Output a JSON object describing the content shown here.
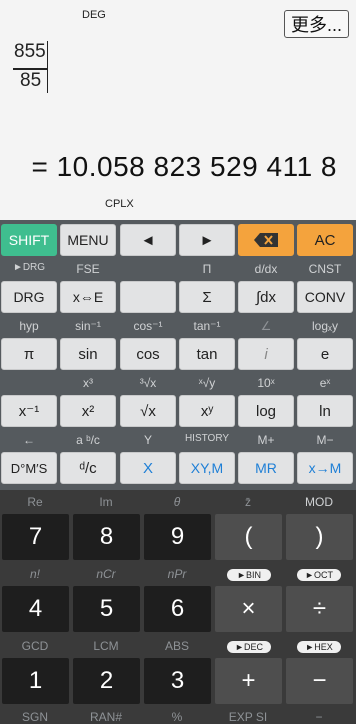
{
  "display": {
    "mode": "DEG",
    "more_label": "更多...",
    "numerator": "855",
    "denominator": "85",
    "result": "= 10.058 823 529 411 8",
    "status": "CPLX"
  },
  "row1": {
    "shift": "SHIFT",
    "menu": "MENU",
    "left": "◄",
    "right": "►",
    "backspace": "⌫",
    "ac": "AC"
  },
  "labels1": {
    "drg2": "►DRG",
    "fse": "FSE",
    "pi2": "Π",
    "ddx": "d/dx",
    "cnst": "CNST"
  },
  "row2": {
    "drg": "DRG",
    "xe": "x⇔E",
    "sigma": "Σ",
    "integral": "∫dx",
    "conv": "CONV"
  },
  "labels2": {
    "hyp": "hyp",
    "asin": "sin⁻¹",
    "acos": "cos⁻¹",
    "atan": "tan⁻¹",
    "angle": "∠",
    "logxy": "logₓy"
  },
  "row3": {
    "pi": "π",
    "sin": "sin",
    "cos": "cos",
    "tan": "tan",
    "i": "i",
    "e": "e"
  },
  "labels3": {
    "cube": "x³",
    "cbrt": "³√x",
    "xroot": "ˣ√y",
    "tenx": "10ˣ",
    "ex": "eˣ"
  },
  "row4": {
    "inv": "x⁻¹",
    "sq": "x²",
    "sqrt": "√x",
    "pow": "xʸ",
    "log": "log",
    "ln": "ln"
  },
  "labels4": {
    "arrow": "←",
    "abc": "a ᵇ/c",
    "y": "Y",
    "history": "HISTORY",
    "mplus": "M+",
    "mminus": "M−"
  },
  "row5": {
    "dms": "D°M′S",
    "dc": "ᵈ/c",
    "x": "X",
    "xym": "XY,M",
    "mr": "MR",
    "xm": "x→M"
  },
  "labels5": {
    "re": "Re",
    "im": "Im",
    "theta": "θ",
    "conj": "z̄",
    "mod": "MOD"
  },
  "row6": {
    "seven": "7",
    "eight": "8",
    "nine": "9",
    "lparen": "(",
    "rparen": ")"
  },
  "labels6": {
    "fact": "n!",
    "ncr": "nCr",
    "npr": "nPr",
    "bin": "►BIN",
    "oct": "►OCT"
  },
  "row7": {
    "four": "4",
    "five": "5",
    "six": "6",
    "mul": "×",
    "div": "÷"
  },
  "labels7": {
    "gcd": "GCD",
    "lcm": "LCM",
    "abs": "ABS",
    "dec": "►DEC",
    "hex": "►HEX"
  },
  "row8": {
    "one": "1",
    "two": "2",
    "three": "3",
    "plus": "+",
    "minus": "−"
  },
  "labels8": {
    "sgn": "SGN",
    "ran": "RAN#",
    "pct": "%",
    "expsi": "EXP SI",
    "neg": "−"
  },
  "colors": {
    "shift": "#3fbe8f",
    "orange": "#f4a33d",
    "blue_text": "#1e7fd6"
  }
}
